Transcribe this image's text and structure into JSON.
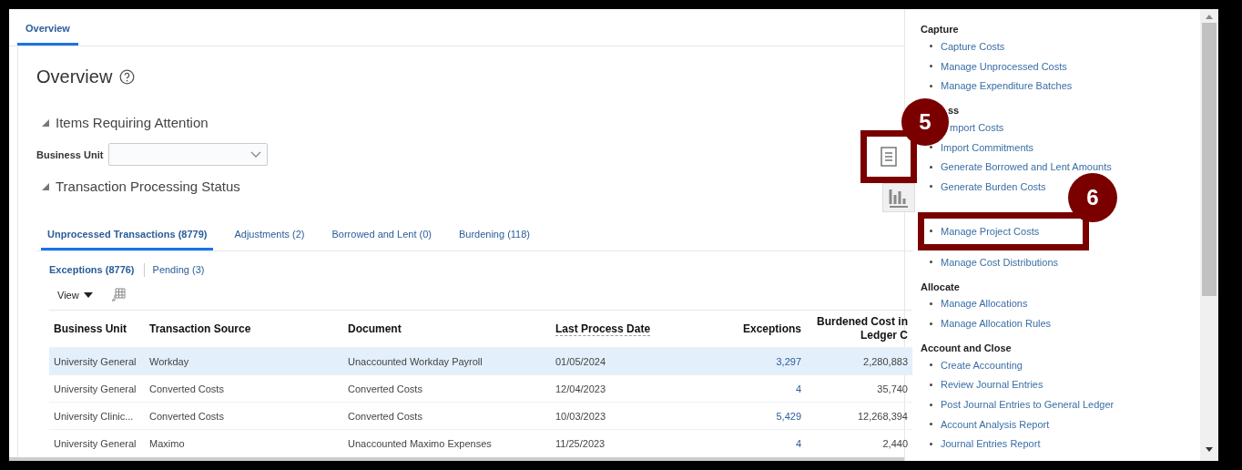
{
  "tabs": [
    {
      "label": "Overview",
      "selected": true
    }
  ],
  "page": {
    "title": "Overview"
  },
  "attention": {
    "heading": "Items Requiring Attention",
    "expanded": true,
    "field_label": "Business Unit"
  },
  "status": {
    "heading": "Transaction Processing Status",
    "expanded": true
  },
  "side_buttons": [
    {
      "kind": "report",
      "highlighted": true
    },
    {
      "kind": "chart",
      "highlighted": false
    }
  ],
  "status_tabs": [
    {
      "label": "Unprocessed Transactions (8779)",
      "selected": true
    },
    {
      "label": "Adjustments (2)",
      "selected": false
    },
    {
      "label": "Borrowed and Lent (0)",
      "selected": false
    },
    {
      "label": "Burdening (118)",
      "selected": false
    }
  ],
  "sub_tabs": [
    {
      "label": "Exceptions (8776)",
      "selected": true
    },
    {
      "label": "Pending (3)",
      "selected": false
    }
  ],
  "toolbar": {
    "view_label": "View"
  },
  "table": {
    "columns": [
      {
        "label": "Business Unit",
        "sortable": false
      },
      {
        "label": "Transaction Source",
        "sortable": false
      },
      {
        "label": "Document",
        "sortable": false
      },
      {
        "label": "Last Process Date",
        "sortable": true
      },
      {
        "label": "Exceptions",
        "sortable": false
      },
      {
        "label": "Burdened Cost in Ledger C",
        "sortable": false
      }
    ],
    "rows": [
      {
        "selected": true,
        "cells": [
          "University General",
          "Workday",
          "Unaccounted Workday Payroll",
          "01/05/2024",
          "3,297",
          "2,280,883"
        ]
      },
      {
        "selected": false,
        "cells": [
          "University General",
          "Converted Costs",
          "Converted Costs",
          "12/04/2023",
          "4",
          "35,740"
        ]
      },
      {
        "selected": false,
        "cells": [
          "University Clinic...",
          "Converted Costs",
          "Converted Costs",
          "10/03/2023",
          "5,429",
          "12,268,394"
        ]
      },
      {
        "selected": false,
        "cells": [
          "University General",
          "Maximo",
          "Unaccounted Maximo Expenses",
          "11/25/2023",
          "4",
          "2,440"
        ]
      }
    ]
  },
  "task_panel": [
    {
      "heading": "Capture",
      "items": [
        {
          "label": "Capture Costs",
          "highlighted": false
        },
        {
          "label": "Manage Unprocessed Costs",
          "highlighted": false
        },
        {
          "label": "Manage Expenditure Batches",
          "highlighted": false
        }
      ]
    },
    {
      "heading": "ss",
      "cut": true,
      "items": [
        {
          "label": "mport Costs",
          "highlighted": false,
          "cut": true
        },
        {
          "label": "Import Commitments",
          "highlighted": false
        },
        {
          "label": "Generate Borrowed and Lent Amounts",
          "highlighted": false
        },
        {
          "label": "Generate Burden Costs",
          "highlighted": false
        }
      ]
    },
    {
      "items": [
        {
          "label": "Manage Project Costs",
          "highlighted": true
        },
        {
          "label": "Manage Cost Distributions",
          "highlighted": false
        }
      ]
    },
    {
      "heading": "Allocate",
      "items": [
        {
          "label": "Manage Allocations",
          "highlighted": false
        },
        {
          "label": "Manage Allocation Rules",
          "highlighted": false
        }
      ]
    },
    {
      "heading": "Account and Close",
      "items": [
        {
          "label": "Create Accounting",
          "highlighted": false
        },
        {
          "label": "Review Journal Entries",
          "highlighted": false
        },
        {
          "label": "Post Journal Entries to General Ledger",
          "highlighted": false
        },
        {
          "label": "Account Analysis Report",
          "highlighted": false
        },
        {
          "label": "Journal Entries Report",
          "highlighted": false
        }
      ]
    }
  ],
  "callouts": [
    {
      "number": "5"
    },
    {
      "number": "6"
    }
  ]
}
